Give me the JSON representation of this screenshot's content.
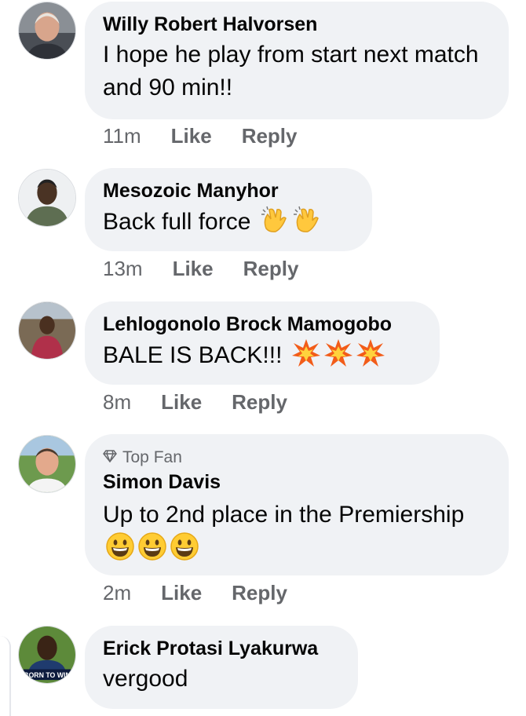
{
  "comments": [
    {
      "author": "Willy Robert Halvorsen",
      "text": "I hope he play from start next match and 90 min!!",
      "time": "11m",
      "like": "Like",
      "reply": "Reply"
    },
    {
      "author": "Mesozoic Manyhor",
      "text": "Back full force",
      "emoji": [
        "clapping-hands",
        "clapping-hands"
      ],
      "time": "13m",
      "like": "Like",
      "reply": "Reply"
    },
    {
      "author": "Lehlogonolo Brock Mamogobo",
      "text": "BALE IS BACK!!!",
      "emoji": [
        "collision",
        "collision",
        "collision"
      ],
      "time": "8m",
      "like": "Like",
      "reply": "Reply"
    },
    {
      "badge": "Top Fan",
      "author": "Simon Davis",
      "text": "Up to 2nd place in the Premiership",
      "emoji": [
        "grinning-face",
        "grinning-face",
        "grinning-face"
      ],
      "time": "2m",
      "like": "Like",
      "reply": "Reply"
    },
    {
      "author": "Erick Protasi Lyakurwa",
      "text": "vergood",
      "avatar_text": "BORN TO WIN"
    }
  ],
  "colors": {
    "bubble": "#f0f2f5",
    "secondary_text": "#65676b",
    "primary_text": "#050505"
  }
}
